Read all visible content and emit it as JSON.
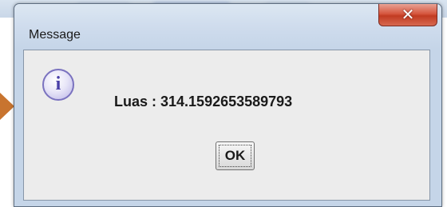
{
  "window": {
    "title": "Message",
    "close_icon": "close-icon"
  },
  "message": {
    "icon": "info-icon",
    "icon_glyph": "i",
    "text": "Luas : 314.1592653589793"
  },
  "buttons": {
    "ok_label": "OK"
  },
  "colors": {
    "close_button": "#c13b22",
    "info_icon_border": "#7a72bf",
    "arrow": "#c8742f"
  }
}
